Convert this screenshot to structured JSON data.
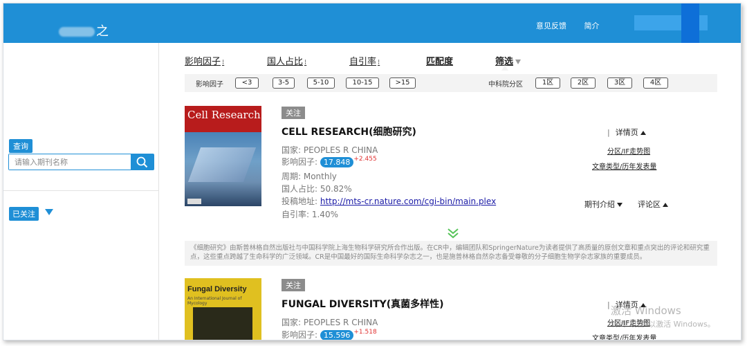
{
  "header": {
    "logo_text": "之",
    "links": [
      "意见反馈",
      "简介"
    ]
  },
  "sidebar": {
    "query_label": "查询",
    "search_placeholder": "请输入期刊名称",
    "followed_label": "已关注"
  },
  "sort": {
    "items": [
      "影响因子",
      "国人占比",
      "自引率",
      "匹配度",
      "筛选"
    ]
  },
  "filters": {
    "if_label": "影响因子",
    "if_ranges": [
      "<3",
      "3-5",
      "5-10",
      "10-15",
      ">15"
    ],
    "cas_label": "中科院分区",
    "cas_zones": [
      "1区",
      "2区",
      "3区",
      "4区"
    ]
  },
  "journals": [
    {
      "follow": "关注",
      "title": "CELL RESEARCH(细胞研究)",
      "cover_title": "Cell Research",
      "country": "国家: PEOPLES R CHINA",
      "if_label": "影响因子:",
      "if_value": "17.848",
      "if_delta": "+2.455",
      "period": "周期: Monthly",
      "chinese_ratio": "国人占比: 50.82%",
      "submit_label": "投稿地址:",
      "submit_url": "http://mts-cr.nature.com/cgi-bin/main.plex",
      "self_cite": "自引率: 1.40%",
      "detail": "详情页",
      "zone_trend": "分区/IF走势图",
      "article_types": "文章类型/历年发表量",
      "intro": "期刊介绍",
      "comments": "评论区",
      "description": "《细胞研究》由斯普林格自然出版社与中国科学院上海生物科学研究所合作出版。在CR中，编辑团队和SpringerNature为读者提供了高质量的原创文章和重点突出的评论和研究重点，这些重点跨越了生命科学的广泛领域。CR是中国最好的国际生命科学杂志之一，也是施普林格自然杂志备受尊敬的分子细胞生物学杂志家族的重要成员。"
    },
    {
      "follow": "关注",
      "title": "FUNGAL DIVERSITY(真菌多样性)",
      "cover_title": "Fungal Diversity",
      "cover_sub": "An International Journal of Mycology",
      "country": "国家: PEOPLES R CHINA",
      "if_label": "影响因子:",
      "if_value": "15.596",
      "if_delta": "+1.518",
      "detail": "详情页",
      "zone_trend": "分区/IF走势图",
      "article_types": "文章类型/历年发表量"
    }
  ],
  "watermark": {
    "line1": "激活 Windows",
    "line2": "转到\"设置\"以激活 Windows。"
  },
  "colors": {
    "brand_blue": "#1f8fd6",
    "delta_red": "#e03030",
    "link_blue": "#1a1aa6"
  }
}
